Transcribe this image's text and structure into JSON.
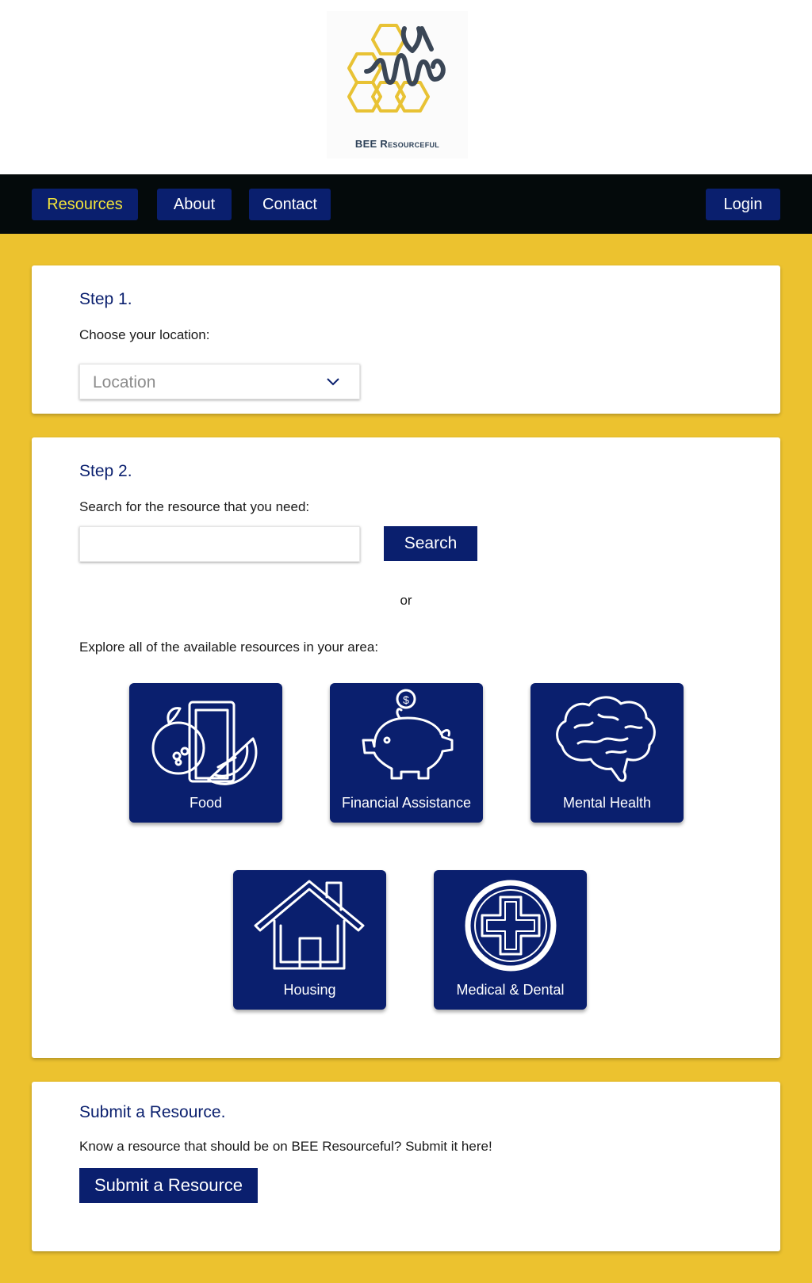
{
  "brand": {
    "name": "BEE Resourceful",
    "logo_icon": "bee-honeycomb-logo",
    "accent": "#ecc22f",
    "navy": "#0a1f6e"
  },
  "nav": {
    "resources": "Resources",
    "about": "About",
    "contact": "Contact",
    "login": "Login"
  },
  "step1": {
    "title": "Step 1.",
    "label": "Choose your location:",
    "select_value": "Location"
  },
  "step2": {
    "title": "Step 2.",
    "search_label": "Search for the resource that you need:",
    "search_placeholder": "",
    "search_button": "Search",
    "or_text": "or",
    "explore_label": "Explore all of the available resources in your area:",
    "categories": [
      {
        "label": "Food",
        "icon": "food-icon"
      },
      {
        "label": "Financial Assistance",
        "icon": "piggy-bank-icon"
      },
      {
        "label": "Mental Health",
        "icon": "brain-icon"
      },
      {
        "label": "Housing",
        "icon": "house-icon"
      },
      {
        "label": "Medical & Dental",
        "icon": "medical-cross-icon"
      }
    ]
  },
  "submit": {
    "title": "Submit a Resource.",
    "text": "Know a resource that should be on BEE Resourceful? Submit it here!",
    "button": "Submit a Resource"
  }
}
